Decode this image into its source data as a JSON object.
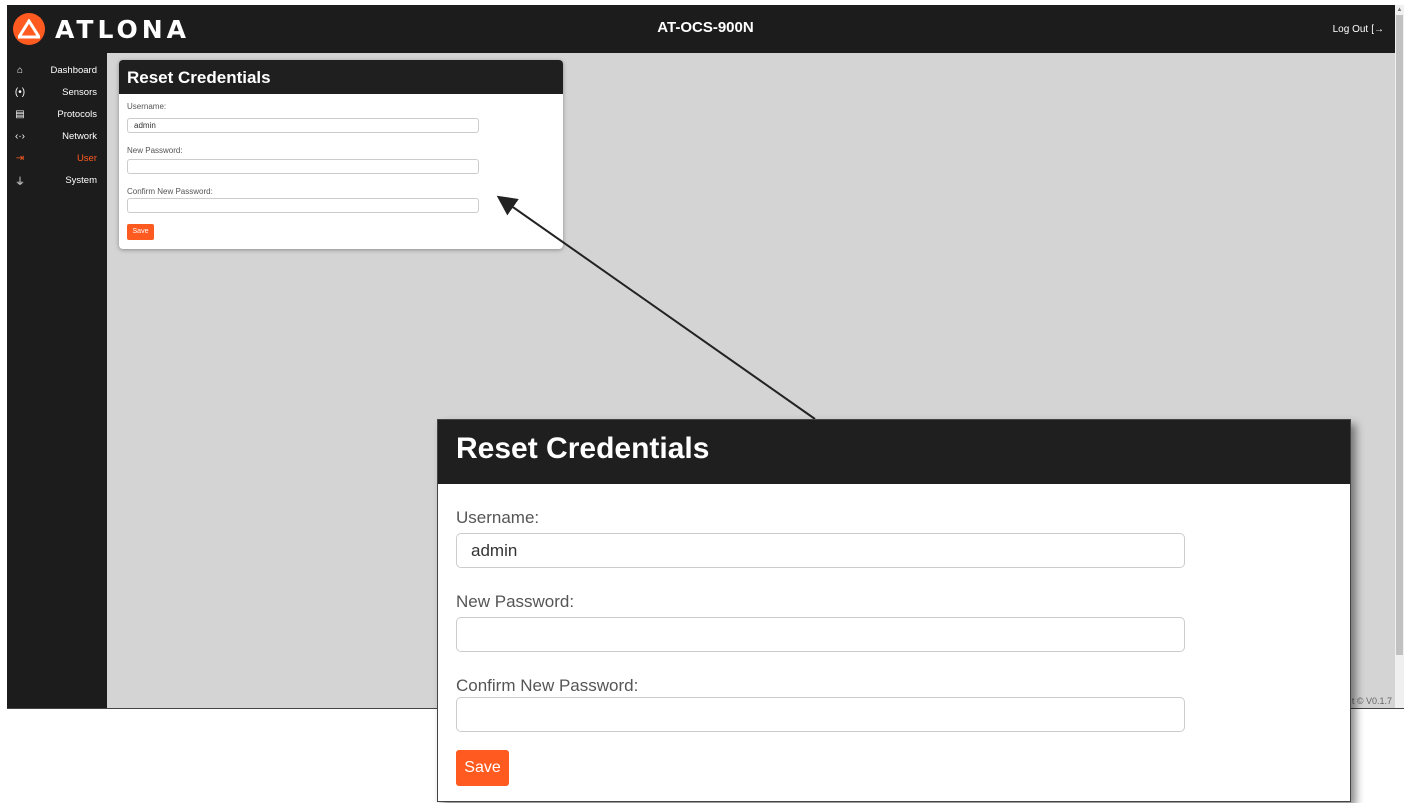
{
  "header": {
    "brand": "ATLONA",
    "device_title": "AT-OCS-900N",
    "logout_label": "Log Out"
  },
  "sidebar": {
    "items": [
      {
        "label": "Dashboard",
        "icon": "home-icon",
        "glyph": "⌂",
        "active": false
      },
      {
        "label": "Sensors",
        "icon": "sensor-icon",
        "glyph": "(•)",
        "active": false
      },
      {
        "label": "Protocols",
        "icon": "server-icon",
        "glyph": "▤",
        "active": false
      },
      {
        "label": "Network",
        "icon": "network-icon",
        "glyph": "‹·›",
        "active": false
      },
      {
        "label": "User",
        "icon": "login-icon",
        "glyph": "⇥",
        "active": true
      },
      {
        "label": "System",
        "icon": "plug-icon",
        "glyph": "⏚",
        "active": false
      }
    ]
  },
  "card": {
    "title": "Reset Credentials",
    "username_label": "Username:",
    "username_value": "admin",
    "new_password_label": "New Password:",
    "new_password_value": "",
    "confirm_password_label": "Confirm New Password:",
    "confirm_password_value": "",
    "save_label": "Save"
  },
  "footer_fragment": "t © V0.1.7",
  "colors": {
    "accent": "#ff5a1f",
    "header_bg": "#1c1c1c",
    "content_bg": "#d4d4d4"
  }
}
